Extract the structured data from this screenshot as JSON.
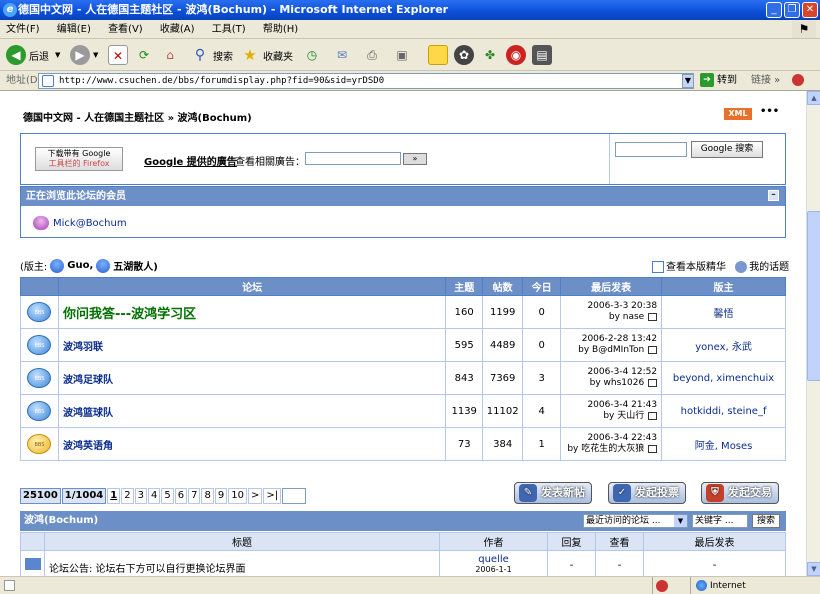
{
  "window": {
    "title": "德国中文网 - 人在德国主题社区 - 波鸿(Bochum) - Microsoft Internet Explorer"
  },
  "menu": [
    "文件(F)",
    "编辑(E)",
    "查看(V)",
    "收藏(A)",
    "工具(T)",
    "帮助(H)"
  ],
  "toolbar": {
    "back": "后退",
    "search": "搜索",
    "favorites": "收藏夹"
  },
  "address": {
    "label": "地址(D)",
    "url": "http://www.csuchen.de/bbs/forumdisplay.php?fid=90&sid=yrDSD0",
    "go": "转到",
    "links": "链接"
  },
  "page": {
    "breadcrumb": "德国中文网 - 人在德国主题社区 » 波鸿(Bochum)",
    "xml_badge": "XML",
    "firefox_button_line1": "下载带有 Google",
    "firefox_button_line2": "工具栏的 Firefox",
    "google_ads_link": "Google 提供的廣告",
    "google_ads_label": "查看相關廣告：",
    "google_ads_button": "»",
    "google_search_button": "Google 搜索",
    "browsing_header": "正在浏览此论坛的会员",
    "browsing_member": "Mick@Bochum",
    "moderator_prefix": "(版主:",
    "moderators": [
      "Guo,",
      "五湖散人)"
    ],
    "view_digest": "查看本版精华",
    "my_topics": "我的话题"
  },
  "forum_table": {
    "headers": [
      "论坛",
      "主题",
      "帖数",
      "今日",
      "最后发表",
      "版主"
    ],
    "rows": [
      {
        "icon": "bubble-blue",
        "name": "你问我答---波鸿学习区",
        "topics": "160",
        "posts": "1199",
        "today": "0",
        "last_time": "2006-3-3 20:38",
        "last_by": "by nase",
        "mods": "馨悟"
      },
      {
        "icon": "bubble-blue",
        "name": "波鸿羽联",
        "topics": "595",
        "posts": "4489",
        "today": "0",
        "last_time": "2006-2-28 13:42",
        "last_by": "by B@dMInTon",
        "mods": "yonex, 永武"
      },
      {
        "icon": "bubble-blue",
        "name": "波鸿足球队",
        "topics": "843",
        "posts": "7369",
        "today": "3",
        "last_time": "2006-3-4 12:52",
        "last_by": "by whs1026",
        "mods": "beyond, ximenchuix"
      },
      {
        "icon": "bubble-blue",
        "name": "波鸿篮球队",
        "topics": "1139",
        "posts": "11102",
        "today": "4",
        "last_time": "2006-3-4 21:43",
        "last_by": "by 天山行",
        "mods": "hotkiddi, steine_f"
      },
      {
        "icon": "bubble-yellow",
        "name": "波鸿英语角",
        "topics": "73",
        "posts": "384",
        "today": "1",
        "last_time": "2006-3-4 22:43",
        "last_by": "by 吃花生的大灰狼",
        "mods": "阿金, Moses"
      }
    ]
  },
  "pager": {
    "total": "25100",
    "pages": "1/1004",
    "numbers": [
      "1",
      "2",
      "3",
      "4",
      "5",
      "6",
      "7",
      "8",
      "9",
      "10",
      ">",
      ">|"
    ]
  },
  "actions": {
    "new_topic": "发表新帖",
    "new_poll": "发起投票",
    "new_trade": "发起交易"
  },
  "threads": {
    "forum_name": "波鸿(Bochum)",
    "sort_select": "最近访问的论坛 ...",
    "keyword": "关键字 ...",
    "search_button": "搜索",
    "headers": [
      "标题",
      "作者",
      "回复",
      "查看",
      "最后发表"
    ],
    "rows": [
      {
        "title": "论坛公告: 论坛右下方可以自行更换论坛界面",
        "author": "quelle",
        "author_date": "2006-1-1",
        "replies": "-",
        "views": "-",
        "last": "-"
      }
    ]
  },
  "status": {
    "zone": "Internet"
  }
}
